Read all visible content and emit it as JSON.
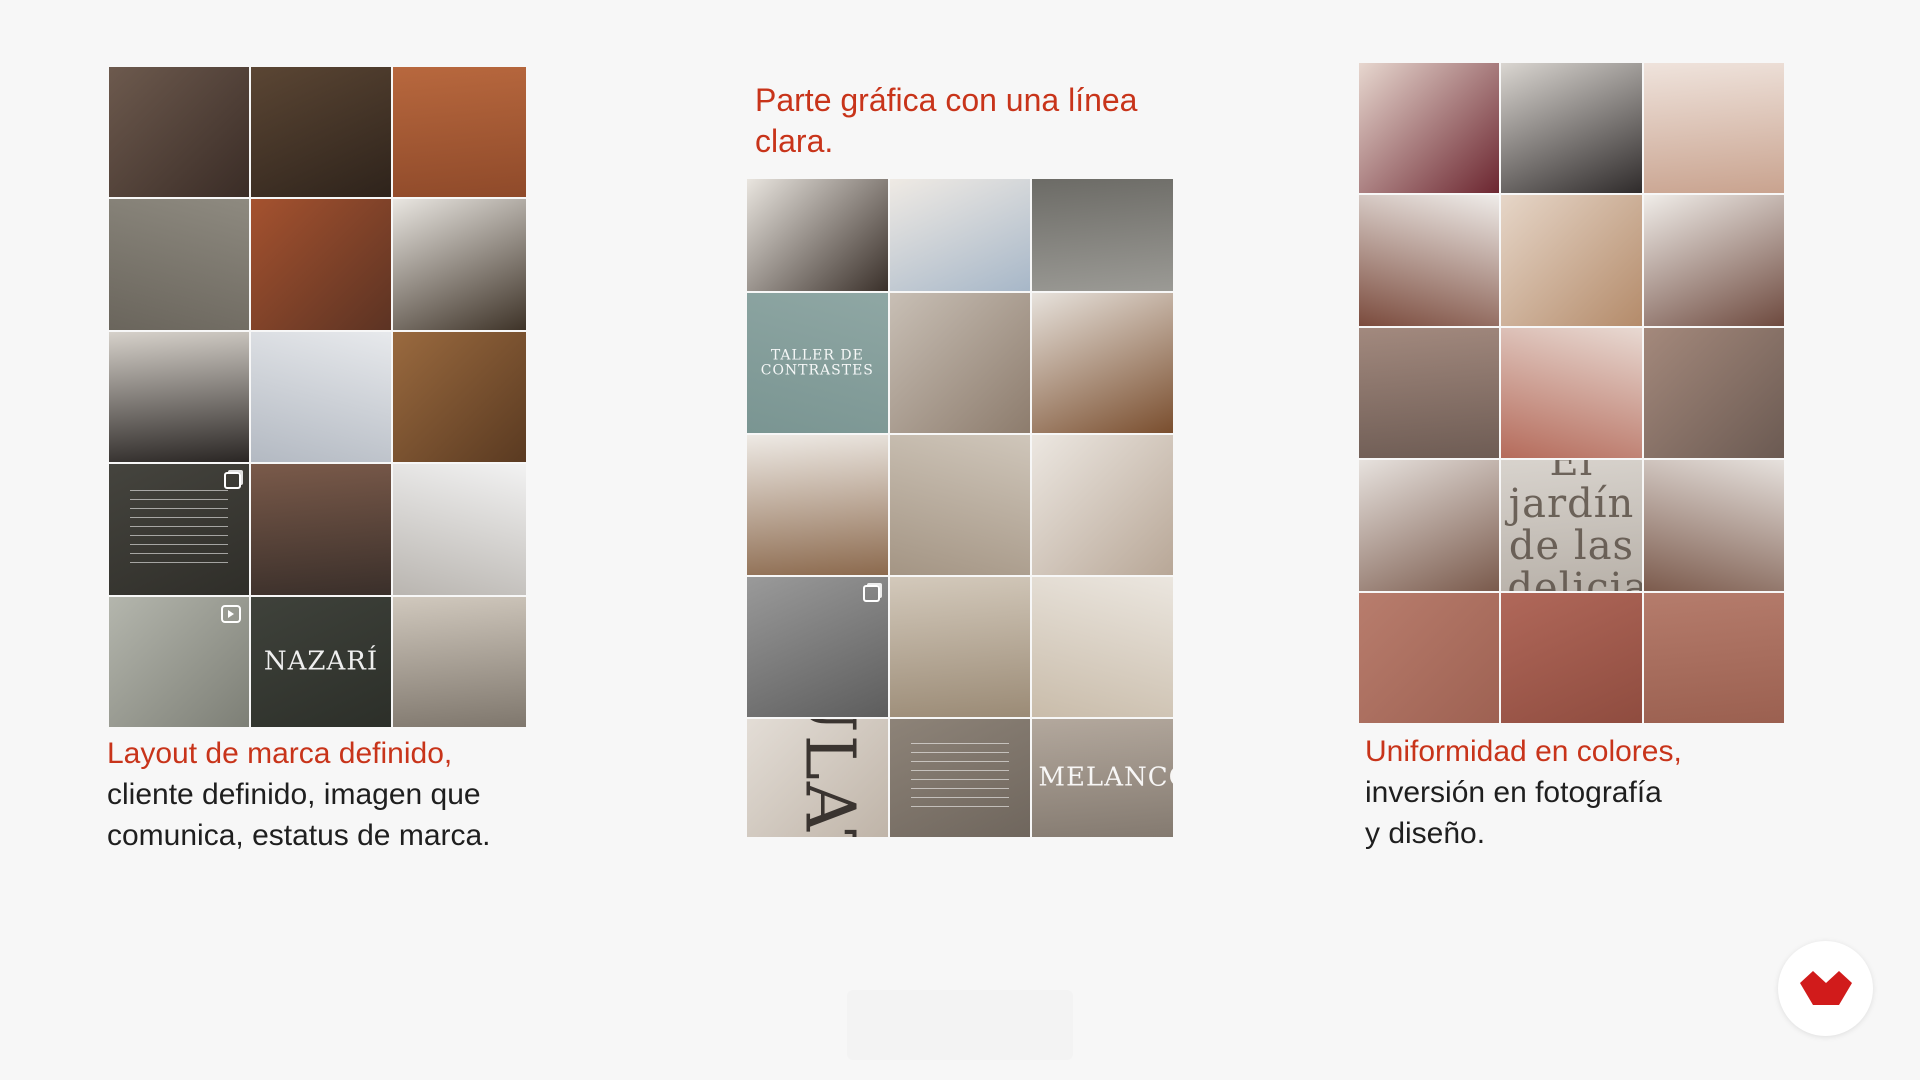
{
  "left_panel": {
    "caption_accent": "Layout de marca definido,",
    "caption_lines": [
      "cliente definido, imagen que",
      "comunica, estatus de marca."
    ],
    "tiles": [
      {
        "kind": "photo",
        "subject": "model-headpiece",
        "colors": [
          "#6d5a4e",
          "#3a2c26"
        ]
      },
      {
        "kind": "photo",
        "subject": "moorish-arch-window",
        "colors": [
          "#5b4634",
          "#2e231b"
        ]
      },
      {
        "kind": "photo",
        "subject": "model-seated-terracotta",
        "colors": [
          "#b8683e",
          "#8f4a2a"
        ]
      },
      {
        "kind": "photo",
        "subject": "embroidered-slippers",
        "colors": [
          "#8e8a80",
          "#6a655c"
        ]
      },
      {
        "kind": "photo",
        "subject": "model-terracotta-backdrop",
        "colors": [
          "#a5522f",
          "#5c3323"
        ]
      },
      {
        "kind": "photo",
        "subject": "beaded-clutch-tassel",
        "colors": [
          "#e9e6e1",
          "#3e3328"
        ]
      },
      {
        "kind": "photo",
        "subject": "model-seated-black",
        "colors": [
          "#d6d1ca",
          "#2a2624"
        ]
      },
      {
        "kind": "photo",
        "subject": "jewel-earrings-crystal",
        "colors": [
          "#e7e9ec",
          "#b3b9c2"
        ]
      },
      {
        "kind": "photo",
        "subject": "alhambra-arches",
        "colors": [
          "#9a6a3f",
          "#5a3a21"
        ]
      },
      {
        "kind": "text",
        "subject": "brand-text-post",
        "colors": [
          "#45443e",
          "#2f2e29"
        ],
        "badge": "carousel"
      },
      {
        "kind": "photo",
        "subject": "model-reclining-silk",
        "colors": [
          "#7a5a4a",
          "#3a2f2a"
        ]
      },
      {
        "kind": "photo",
        "subject": "crystal-headband",
        "colors": [
          "#f2f2f2",
          "#b9b5b0"
        ]
      },
      {
        "kind": "photo",
        "subject": "slippers-on-feet",
        "colors": [
          "#b4b6ad",
          "#7d7f76"
        ],
        "badge": "reel"
      },
      {
        "kind": "logo",
        "subject": "nazari-logo",
        "colors": [
          "#3f423b",
          "#2c2f29"
        ],
        "overlay": "NAZARÍ"
      },
      {
        "kind": "photo",
        "subject": "model-sequin",
        "colors": [
          "#d0c8bd",
          "#7f776d"
        ]
      }
    ]
  },
  "center_panel": {
    "heading_lines": [
      "Parte gráfica con una línea",
      "clara."
    ],
    "tiles": [
      {
        "kind": "photo",
        "subject": "studded-slippers",
        "colors": [
          "#e9e5df",
          "#3a302a"
        ]
      },
      {
        "kind": "photo",
        "subject": "wide-jeans-model",
        "colors": [
          "#efeae4",
          "#a7b7c8"
        ]
      },
      {
        "kind": "photo",
        "subject": "botanical-leaves",
        "colors": [
          "#6c6b66",
          "#9b9a95"
        ]
      },
      {
        "kind": "text",
        "subject": "taller-de-contrastes",
        "colors": [
          "#8fa7a4",
          "#7a9592"
        ],
        "overlay": "TALLER DE CONTRASTES"
      },
      {
        "kind": "photo",
        "subject": "model-bare-shoulder",
        "colors": [
          "#c8bfb5",
          "#8d7c6d"
        ]
      },
      {
        "kind": "photo",
        "subject": "gold-floral-headband",
        "colors": [
          "#e7e2dc",
          "#7a4e2e"
        ]
      },
      {
        "kind": "photo",
        "subject": "model-butterfly-chair",
        "colors": [
          "#eeeae5",
          "#8c6a4e"
        ]
      },
      {
        "kind": "photo",
        "subject": "beige-embroidered-slippers",
        "colors": [
          "#cfc6ba",
          "#a49584"
        ]
      },
      {
        "kind": "photo",
        "subject": "model-turban",
        "colors": [
          "#ece7e1",
          "#b8a797"
        ]
      },
      {
        "kind": "photo",
        "subject": "earring-monochrome",
        "colors": [
          "#9a9a9a",
          "#5d5d5d"
        ],
        "badge": "carousel"
      },
      {
        "kind": "photo",
        "subject": "model-blazer-necklace",
        "colors": [
          "#d3c9bb",
          "#9b8b76"
        ]
      },
      {
        "kind": "photo",
        "subject": "legs-black-slippers",
        "colors": [
          "#ebe6df",
          "#c9bcaa"
        ]
      },
      {
        "kind": "text",
        "subject": "vertical-type-model",
        "colors": [
          "#e3ddd6",
          "#bfb4a8"
        ],
        "overlay": "ULAT"
      },
      {
        "kind": "text",
        "subject": "text-post-taupe",
        "colors": [
          "#8d8378",
          "#6f665d"
        ]
      },
      {
        "kind": "text",
        "subject": "melancolia-model",
        "colors": [
          "#b3a89d",
          "#847a70"
        ],
        "overlay": "MELANCOLÍA"
      }
    ]
  },
  "right_panel": {
    "caption_accent": "Uniformidad en colores,",
    "caption_lines": [
      "inversión   en   fotografía",
      "y diseño."
    ],
    "tiles": [
      {
        "kind": "photo",
        "subject": "velvet-hair-bow",
        "colors": [
          "#e7d7cf",
          "#6c2630"
        ]
      },
      {
        "kind": "photo",
        "subject": "two-models-lace",
        "colors": [
          "#dad6d1",
          "#2f2b2b"
        ]
      },
      {
        "kind": "photo",
        "subject": "model-floral-earring",
        "colors": [
          "#efe3dc",
          "#c9a38f"
        ]
      },
      {
        "kind": "photo",
        "subject": "model-white-blouse",
        "colors": [
          "#efece9",
          "#7b4b3d"
        ]
      },
      {
        "kind": "photo",
        "subject": "jeweled-headbands",
        "colors": [
          "#e6d6c8",
          "#b48b6a"
        ]
      },
      {
        "kind": "photo",
        "subject": "model-white-blouse-2",
        "colors": [
          "#f0ede9",
          "#6e4a3f"
        ]
      },
      {
        "kind": "photo",
        "subject": "dried-flowers",
        "colors": [
          "#a2897e",
          "#6e5c54"
        ]
      },
      {
        "kind": "photo",
        "subject": "model-rose-headband",
        "colors": [
          "#e8d9d2",
          "#b56b5b"
        ]
      },
      {
        "kind": "photo",
        "subject": "dried-flowers-2",
        "colors": [
          "#a4897c",
          "#6b5a52"
        ]
      },
      {
        "kind": "photo",
        "subject": "model-profile-headband",
        "colors": [
          "#e7e2de",
          "#7a5a4c"
        ]
      },
      {
        "kind": "text",
        "subject": "el-jardin-de-las-delicias",
        "colors": [
          "#d8d3cd",
          "#b8b1a9"
        ],
        "overlay": "El jardín de las delicias"
      },
      {
        "kind": "photo",
        "subject": "model-profile-headband-2",
        "colors": [
          "#e6e1dd",
          "#7c5b4d"
        ]
      },
      {
        "kind": "photo",
        "subject": "terracotta-texture",
        "colors": [
          "#b87d6d",
          "#9e6152"
        ]
      },
      {
        "kind": "photo",
        "subject": "terracotta-hands",
        "colors": [
          "#b0685a",
          "#8f4c3f"
        ]
      },
      {
        "kind": "photo",
        "subject": "terracotta-texture-2",
        "colors": [
          "#b57c6c",
          "#9b6050"
        ]
      }
    ]
  },
  "logo": {
    "name": "unir-logo",
    "color": "#d11b1b"
  }
}
